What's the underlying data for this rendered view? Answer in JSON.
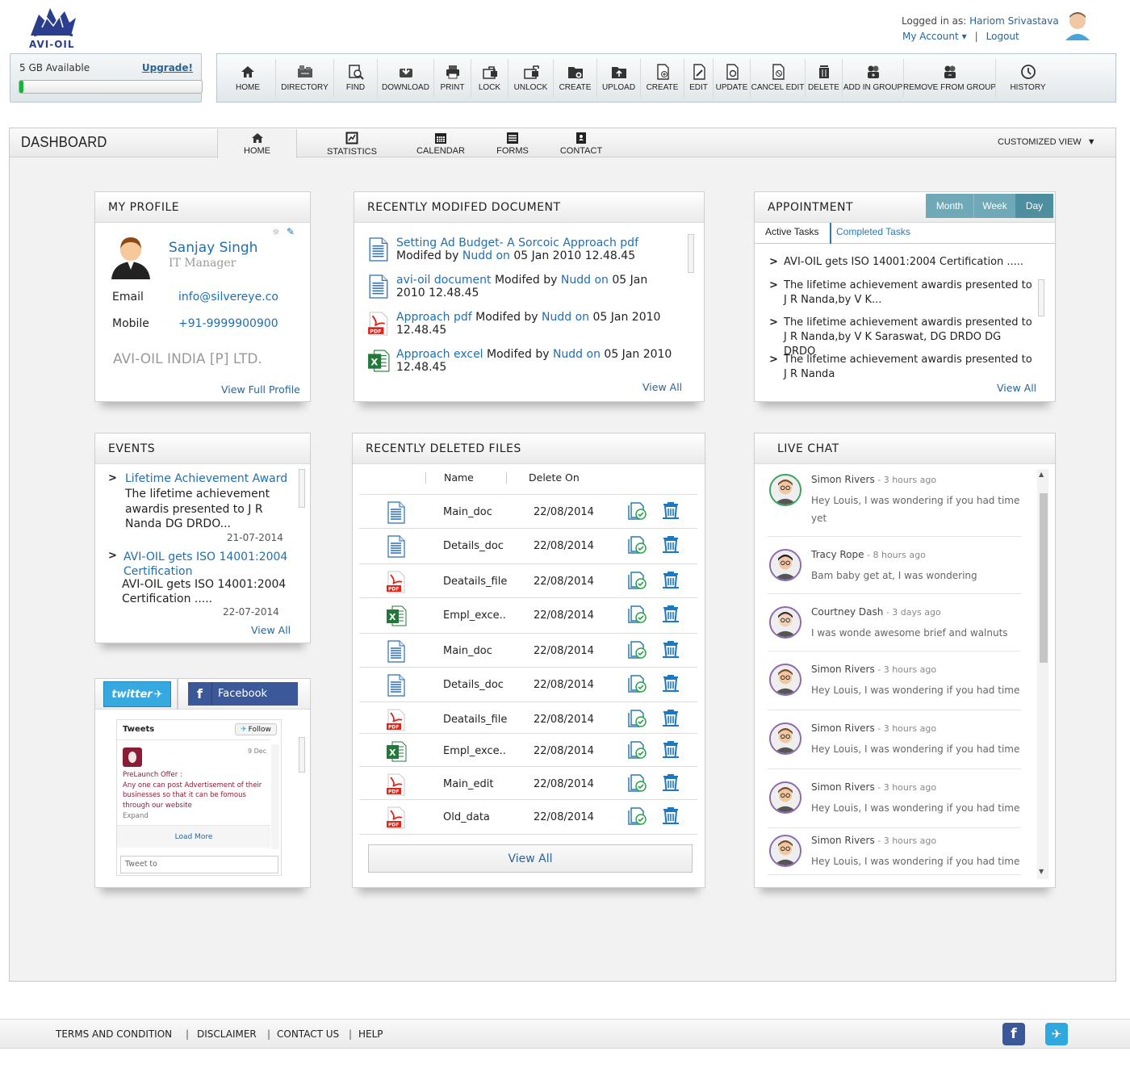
{
  "brand": {
    "logo_text": "AVI-OIL",
    "brand_color": "#2b3e8e"
  },
  "user": {
    "logged_label": "Logged in as:",
    "name": "Hariom Srivastava",
    "my_account": "My Account",
    "logout": "Logout"
  },
  "storage": {
    "available": "5 GB Available",
    "upgrade": "Upgrade!",
    "used_fraction": 0.02
  },
  "toolbar": [
    {
      "label": "HOME",
      "icon": "home-icon"
    },
    {
      "label": "DIRECTORY",
      "icon": "directory-icon"
    },
    {
      "label": "FIND",
      "icon": "find-icon"
    },
    {
      "label": "DOWNLOAD",
      "icon": "download-icon"
    },
    {
      "label": "PRINT",
      "icon": "print-icon"
    },
    {
      "label": "LOCK",
      "icon": "lock-icon"
    },
    {
      "label": "UNLOCK",
      "icon": "unlock-icon"
    },
    {
      "label": "CREATE",
      "icon": "create-folder-icon"
    },
    {
      "label": "UPLOAD",
      "icon": "upload-icon"
    },
    {
      "label": "CREATE",
      "icon": "create-doc-icon"
    },
    {
      "label": "EDIT",
      "icon": "edit-icon"
    },
    {
      "label": "UPDATE",
      "icon": "update-icon"
    },
    {
      "label": "CANCEL EDIT",
      "icon": "cancel-edit-icon"
    },
    {
      "label": "DELETE",
      "icon": "delete-icon"
    },
    {
      "label": "ADD IN GROUP",
      "icon": "add-group-icon"
    },
    {
      "label": "REMOVE FROM GROUP",
      "icon": "remove-group-icon"
    },
    {
      "label": "HISTORY",
      "icon": "history-icon"
    }
  ],
  "dashboard": {
    "title": "DASHBOARD",
    "tabs": [
      "HOME",
      "STATISTICS",
      "CALENDAR",
      "FORMS",
      "CONTACT"
    ],
    "customized_view": "CUSTOMIZED VIEW"
  },
  "profile": {
    "title": "MY PROFILE",
    "name": "Sanjay Singh",
    "role": "IT Manager",
    "email_label": "Email",
    "email": "info@silvereye.co",
    "mobile_label": "Mobile",
    "mobile": "+91-9999900900",
    "company": "AVI-OIL INDIA [P] LTD.",
    "view_full": "View Full Profile"
  },
  "recent_docs": {
    "title": "RECENTLY MODIFED DOCUMENT",
    "items": [
      {
        "type": "doc",
        "name": "Setting Ad Budget- A Sorcoic  Approach pdf",
        "mod": " Modifed by ",
        "by": "Nudd on",
        "date": " 05 Jan 2010 12.48.45"
      },
      {
        "type": "doc",
        "name": "avi-oil document",
        "mod": " Modifed by ",
        "by": "Nudd on",
        "date": " 05 Jan 2010 12.48.45"
      },
      {
        "type": "pdf",
        "name": "Approach pdf",
        "mod": " Modifed by ",
        "by": "Nudd on",
        "date": " 05 Jan 2010 12.48.45"
      },
      {
        "type": "xls",
        "name": "Approach excel",
        "mod": " Modifed by  ",
        "by": "Nudd on",
        "date": " 05 Jan 2010 12.48.45"
      }
    ],
    "view_all": "View All"
  },
  "appointment": {
    "title": "APPOINTMENT",
    "segments": [
      "Month",
      "Week",
      "Day"
    ],
    "tabs": [
      "Active Tasks",
      "Completed Tasks"
    ],
    "tasks": [
      "AVI-OIL gets ISO 14001:2004 Certification .....",
      "The lifetime achievement awardis presented to J R Nanda,by V K...",
      "The lifetime achievement awardis presented to J R Nanda,by V K Saraswat, DG DRDO DG DRDO",
      "The lifetime achievement awardis presented to J R Nanda"
    ],
    "view_all": "View All"
  },
  "events": {
    "title": "EVENTS",
    "items": [
      {
        "title": "Lifetime Achievement Award",
        "text": "The lifetime achievement awardis presented to J R Nanda DG DRDO...",
        "date": "21-07-2014"
      },
      {
        "title": "AVI-OIL gets ISO 14001:2004 Certification",
        "text": "AVI-OIL gets ISO 14001:2004 Certification .....",
        "date": "22-07-2014"
      }
    ],
    "view_all": "View All"
  },
  "deleted": {
    "title": "RECENTLY DELETED  FILES",
    "col_name": "Name",
    "col_date": "Delete On",
    "rows": [
      {
        "type": "doc",
        "name": "Main_doc",
        "date": "22/08/2014"
      },
      {
        "type": "doc",
        "name": "Details_doc",
        "date": "22/08/2014"
      },
      {
        "type": "pdf",
        "name": "Deatails_file",
        "date": "22/08/2014"
      },
      {
        "type": "xls",
        "name": "Empl_exce..",
        "date": "22/08/2014"
      },
      {
        "type": "doc",
        "name": "Main_doc",
        "date": "22/08/2014"
      },
      {
        "type": "doc",
        "name": "Details_doc",
        "date": "22/08/2014"
      },
      {
        "type": "pdf",
        "name": "Deatails_file",
        "date": "22/08/2014"
      },
      {
        "type": "xls",
        "name": "Empl_exce..",
        "date": "22/08/2014"
      },
      {
        "type": "pdf",
        "name": "Main_edit",
        "date": "22/08/2014"
      },
      {
        "type": "pdf",
        "name": "Old_data",
        "date": "22/08/2014"
      }
    ],
    "view_all": "View All"
  },
  "chat": {
    "title": "LIVE CHAT",
    "messages": [
      {
        "name": "Simon Rivers",
        "ago": " - 3 hours ago",
        "text": "Hey Louis, I was wondering if you had time yet"
      },
      {
        "name": "Tracy Rope",
        "ago": " - 8 hours ago",
        "text": "Bam baby get at, I was wondering"
      },
      {
        "name": "Courtney Dash",
        "ago": " - 3 days ago",
        "text": "I was wonde awesome brief and walnuts"
      },
      {
        "name": "Simon Rivers",
        "ago": " - 3 hours ago",
        "text": "Hey Louis, I was wondering if you had time"
      },
      {
        "name": "Simon Rivers",
        "ago": " - 3 hours ago",
        "text": "Hey Louis, I was wondering if you had time"
      },
      {
        "name": "Simon Rivers",
        "ago": " - 3 hours ago",
        "text": "Hey Louis, I was wondering if you had time"
      },
      {
        "name": "Simon Rivers",
        "ago": " - 3 hours ago",
        "text": "Hey Louis, I was wondering if you had time"
      }
    ]
  },
  "social": {
    "twitter_label": "twitter",
    "facebook_label": "Facebook",
    "tweets_label": "Tweets",
    "follow_label": "Follow",
    "tweet_date": "9 Dec",
    "tweet_text": "PreLaunch Offer :\nAny one can post Advertisement of their businesses so that it can be fomous through our website",
    "expand": "Expand",
    "load_more": "Load More",
    "tweet_to": "Tweet to"
  },
  "footer": {
    "links": [
      "TERMS AND CONDITION",
      "DISCLAIMER",
      "CONTACT US",
      "HELP"
    ]
  }
}
